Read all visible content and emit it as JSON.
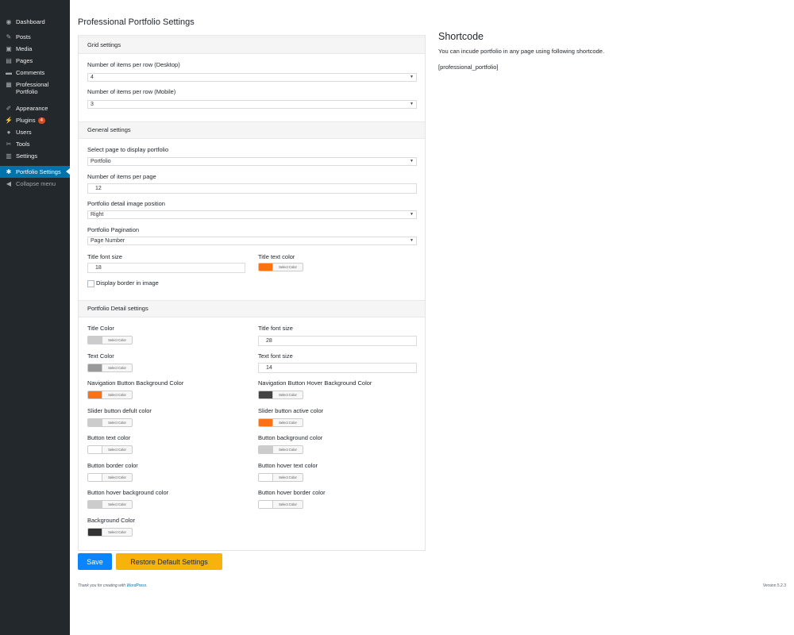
{
  "sidebar": {
    "items": [
      {
        "label": "Dashboard",
        "icon": "dashboard-icon",
        "glyph": "◉"
      },
      {
        "label": "Posts",
        "icon": "pin-icon",
        "glyph": "✎"
      },
      {
        "label": "Media",
        "icon": "media-icon",
        "glyph": "▣"
      },
      {
        "label": "Pages",
        "icon": "pages-icon",
        "glyph": "▤"
      },
      {
        "label": "Comments",
        "icon": "comment-icon",
        "glyph": "▬"
      },
      {
        "label": "Professional Portfolio",
        "icon": "portfolio-icon",
        "glyph": "▦"
      },
      {
        "label": "Appearance",
        "icon": "brush-icon",
        "glyph": "✐"
      },
      {
        "label": "Plugins",
        "icon": "plugin-icon",
        "glyph": "⚡",
        "badge": "4"
      },
      {
        "label": "Users",
        "icon": "user-icon",
        "glyph": "●"
      },
      {
        "label": "Tools",
        "icon": "wrench-icon",
        "glyph": "✂"
      },
      {
        "label": "Settings",
        "icon": "settings-icon",
        "glyph": "▥"
      },
      {
        "label": "Portfolio Settings",
        "icon": "gear-icon",
        "glyph": "✱"
      },
      {
        "label": "Collapse menu",
        "icon": "collapse-icon",
        "glyph": "◀"
      }
    ]
  },
  "page": {
    "title": "Professional Portfolio Settings"
  },
  "grid": {
    "heading": "Grid settings",
    "desktop_label": "Number of items per row (Desktop)",
    "desktop_value": "4",
    "mobile_label": "Number of items per row (Mobile)",
    "mobile_value": "3"
  },
  "general": {
    "heading": "General settings",
    "page_label": "Select page to display portfolio",
    "page_value": "Portfolio",
    "per_page_label": "Number of items per page",
    "per_page_value": "12",
    "image_pos_label": "Portfolio detail image position",
    "image_pos_value": "Right",
    "pagination_label": "Portfolio Pagination",
    "pagination_value": "Page Number",
    "title_font_label": "Title font size",
    "title_font_value": "18",
    "title_color_label": "Title text color",
    "title_color": "#f97316",
    "border_label": "Display border in image"
  },
  "detail": {
    "heading": "Portfolio Detail settings",
    "title_color_label": "Title Color",
    "title_color": "#cccccc",
    "title_font_label": "Title font size",
    "title_font_value": "28",
    "text_color_label": "Text Color",
    "text_color": "#999999",
    "text_font_label": "Text font size",
    "text_font_value": "14",
    "nav_bg_label": "Navigation Button Background Color",
    "nav_bg_color": "#f97316",
    "nav_hover_label": "Navigation Button Hover Background Color",
    "nav_hover_color": "#444444",
    "slider_default_label": "Slider button defult color",
    "slider_default_color": "#cccccc",
    "slider_active_label": "Slider button active color",
    "slider_active_color": "#f97316",
    "btn_text_label": "Button text color",
    "btn_text_color": "#ffffff",
    "btn_bg_label": "Button background color",
    "btn_bg_color": "#cccccc",
    "btn_border_label": "Button border color",
    "btn_border_color": "#ffffff",
    "btn_hover_text_label": "Button hover text color",
    "btn_hover_text_color": "#ffffff",
    "btn_hover_bg_label": "Button hover background color",
    "btn_hover_bg_color": "#cccccc",
    "btn_hover_border_label": "Button hover border color",
    "btn_hover_border_color": "#ffffff",
    "bg_label": "Background Color",
    "bg_color": "#333333"
  },
  "common": {
    "select_color": "Select Color",
    "dropdown_arrow": "▼"
  },
  "actions": {
    "save": "Save",
    "restore": "Restore Default Settings"
  },
  "shortcode": {
    "title": "Shortcode",
    "description": "You can incude portfolio in any page using following shortcode.",
    "code": "[professional_portfolio]"
  },
  "footer": {
    "thanks": "Thank you for creating with ",
    "wp_link": "WordPress",
    "thanks_end": ".",
    "version": "Version 5.2.3"
  }
}
